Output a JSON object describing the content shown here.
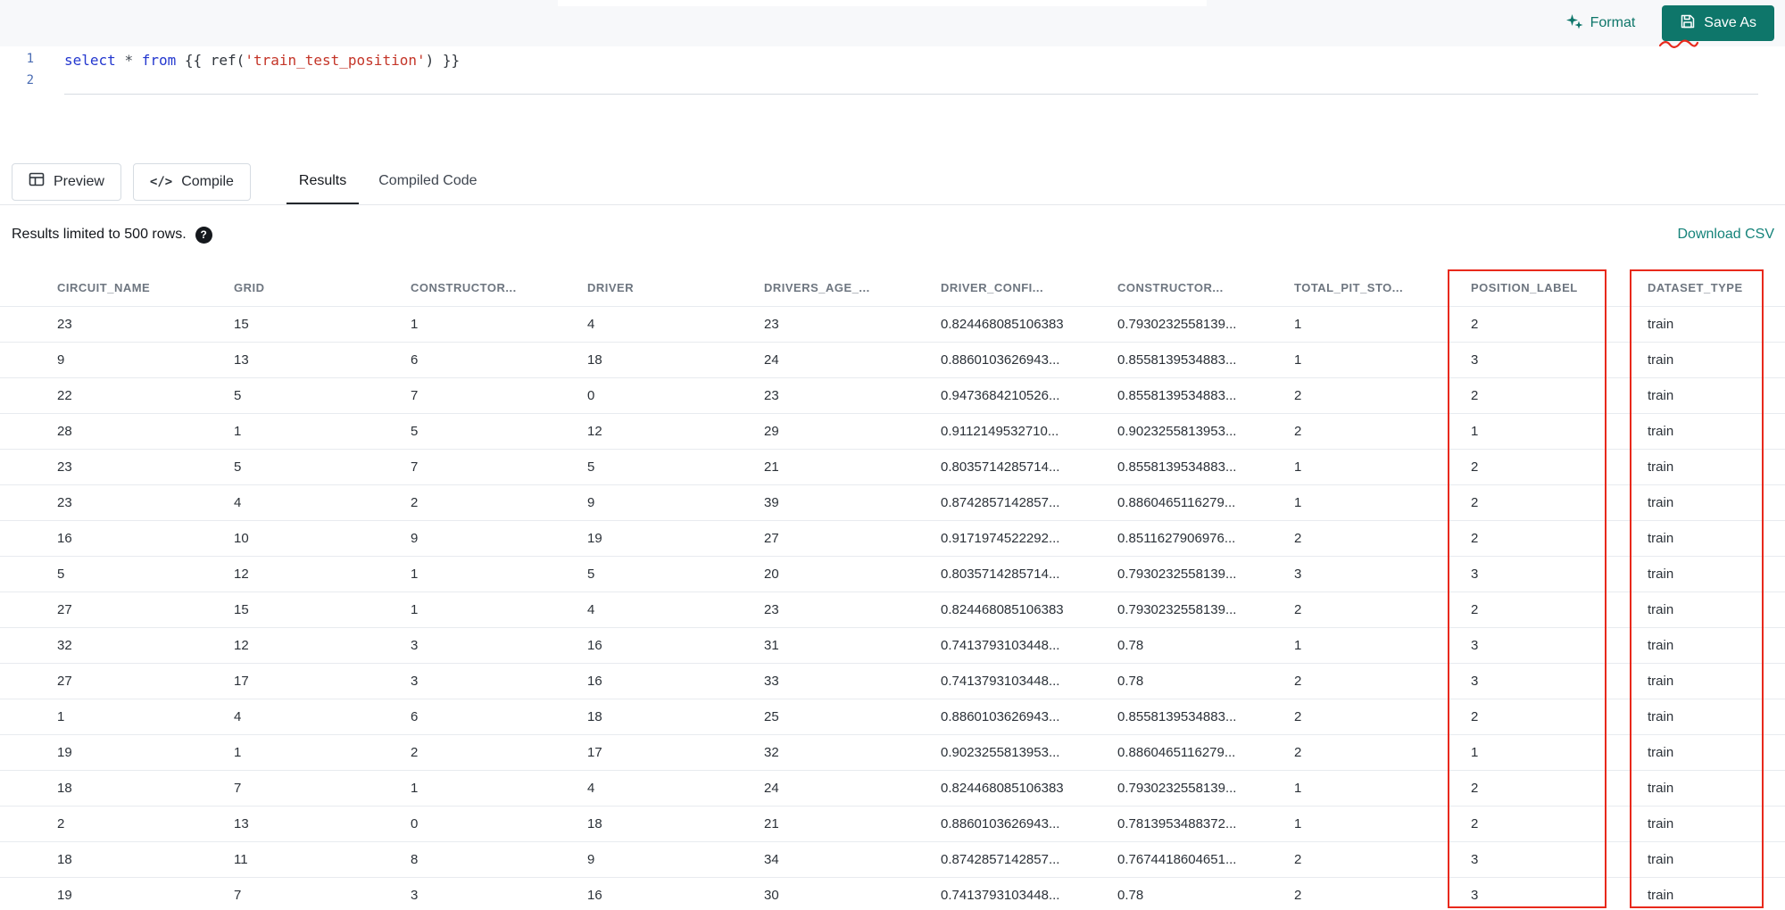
{
  "topbar": {
    "format_label": "Format",
    "save_as_label": "Save As"
  },
  "editor": {
    "line_numbers": [
      "1",
      "2"
    ],
    "code_tokens": [
      {
        "text": "select",
        "type": "keyword"
      },
      {
        "text": " ",
        "type": "plain"
      },
      {
        "text": "*",
        "type": "operator"
      },
      {
        "text": " ",
        "type": "plain"
      },
      {
        "text": "from",
        "type": "keyword"
      },
      {
        "text": " {{ ref(",
        "type": "plain"
      },
      {
        "text": "'train_test_position'",
        "type": "string"
      },
      {
        "text": ") }}",
        "type": "plain"
      }
    ]
  },
  "actions": {
    "preview_label": "Preview",
    "compile_label": "Compile"
  },
  "tabs": [
    {
      "label": "Results",
      "active": true
    },
    {
      "label": "Compiled Code",
      "active": false
    }
  ],
  "results_bar": {
    "limit_text": "Results limited to 500 rows.",
    "help_icon": "?",
    "download_label": "Download CSV"
  },
  "table": {
    "columns": [
      "CIRCUIT_NAME",
      "GRID",
      "CONSTRUCTOR...",
      "DRIVER",
      "DRIVERS_AGE_...",
      "DRIVER_CONFI...",
      "CONSTRUCTOR...",
      "TOTAL_PIT_STO...",
      "POSITION_LABEL",
      "DATASET_TYPE"
    ],
    "rows": [
      [
        "23",
        "15",
        "1",
        "4",
        "23",
        "0.824468085106383",
        "0.7930232558139...",
        "1",
        "2",
        "train"
      ],
      [
        "9",
        "13",
        "6",
        "18",
        "24",
        "0.8860103626943...",
        "0.8558139534883...",
        "1",
        "3",
        "train"
      ],
      [
        "22",
        "5",
        "7",
        "0",
        "23",
        "0.9473684210526...",
        "0.8558139534883...",
        "2",
        "2",
        "train"
      ],
      [
        "28",
        "1",
        "5",
        "12",
        "29",
        "0.9112149532710...",
        "0.9023255813953...",
        "2",
        "1",
        "train"
      ],
      [
        "23",
        "5",
        "7",
        "5",
        "21",
        "0.8035714285714...",
        "0.8558139534883...",
        "1",
        "2",
        "train"
      ],
      [
        "23",
        "4",
        "2",
        "9",
        "39",
        "0.8742857142857...",
        "0.8860465116279...",
        "1",
        "2",
        "train"
      ],
      [
        "16",
        "10",
        "9",
        "19",
        "27",
        "0.9171974522292...",
        "0.8511627906976...",
        "2",
        "2",
        "train"
      ],
      [
        "5",
        "12",
        "1",
        "5",
        "20",
        "0.8035714285714...",
        "0.7930232558139...",
        "3",
        "3",
        "train"
      ],
      [
        "27",
        "15",
        "1",
        "4",
        "23",
        "0.824468085106383",
        "0.7930232558139...",
        "2",
        "2",
        "train"
      ],
      [
        "32",
        "12",
        "3",
        "16",
        "31",
        "0.7413793103448...",
        "0.78",
        "1",
        "3",
        "train"
      ],
      [
        "27",
        "17",
        "3",
        "16",
        "33",
        "0.7413793103448...",
        "0.78",
        "2",
        "3",
        "train"
      ],
      [
        "1",
        "4",
        "6",
        "18",
        "25",
        "0.8860103626943...",
        "0.8558139534883...",
        "2",
        "2",
        "train"
      ],
      [
        "19",
        "1",
        "2",
        "17",
        "32",
        "0.9023255813953...",
        "0.8860465116279...",
        "2",
        "1",
        "train"
      ],
      [
        "18",
        "7",
        "1",
        "4",
        "24",
        "0.824468085106383",
        "0.7930232558139...",
        "1",
        "2",
        "train"
      ],
      [
        "2",
        "13",
        "0",
        "18",
        "21",
        "0.8860103626943...",
        "0.7813953488372...",
        "1",
        "2",
        "train"
      ],
      [
        "18",
        "11",
        "8",
        "9",
        "34",
        "0.8742857142857...",
        "0.7674418604651...",
        "2",
        "3",
        "train"
      ],
      [
        "19",
        "7",
        "3",
        "16",
        "30",
        "0.7413793103448...",
        "0.78",
        "2",
        "3",
        "train"
      ]
    ]
  },
  "annotations": {
    "highlight_color": "#e8291c",
    "boxed_columns": [
      "POSITION_LABEL",
      "DATASET_TYPE"
    ]
  },
  "colors": {
    "accent_teal": "#0e766a"
  }
}
